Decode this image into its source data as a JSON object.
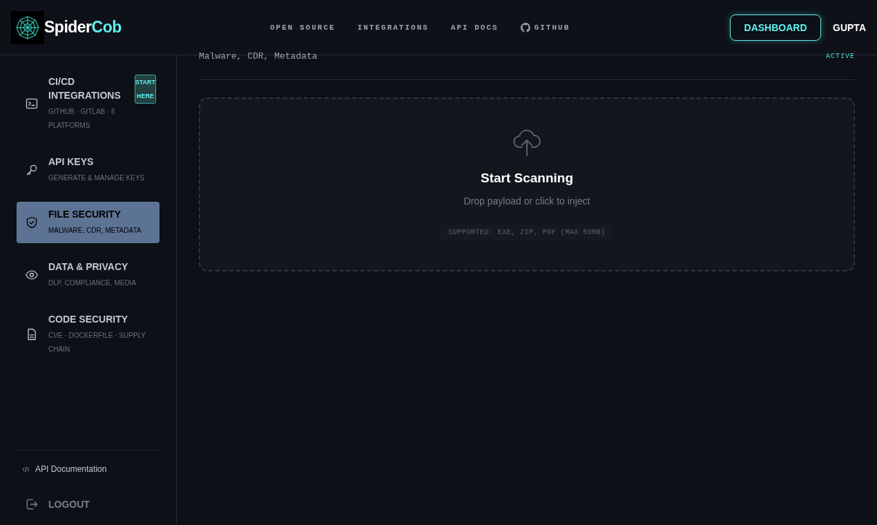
{
  "brand": {
    "name_first": "Spider",
    "name_second": "Cob"
  },
  "nav": [
    {
      "label": "OPEN SOURCE",
      "kind": "text"
    },
    {
      "label": "INTEGRATIONS",
      "kind": "text"
    },
    {
      "label": "API DOCS",
      "kind": "text"
    },
    {
      "label": "GITHUB",
      "kind": "github"
    }
  ],
  "dashboard_button": "DASHBOARD",
  "user": "GUPTA",
  "sidebar": {
    "items": [
      {
        "title": "CI/CD INTEGRATIONS",
        "subtitle": "GITHUB · GITLAB · 6 PLATFORMS",
        "kind": "terminal",
        "badge": "START HERE",
        "selected": false
      },
      {
        "title": "API KEYS",
        "subtitle": "GENERATE & MANAGE KEYS",
        "kind": "key",
        "selected": false
      },
      {
        "title": "FILE SECURITY",
        "subtitle": "MALWARE, CDR, METADATA",
        "kind": "shield",
        "selected": true
      },
      {
        "title": "DATA & PRIVACY",
        "subtitle": "DLP, COMPLIANCE, MEDIA",
        "kind": "eye",
        "selected": false
      },
      {
        "title": "CODE SECURITY",
        "subtitle": "CVE · DOCKERFILE · SUPPLY CHAIN",
        "kind": "file",
        "selected": false
      }
    ],
    "docs_link": "API Documentation",
    "logout": "LOGOUT"
  },
  "section": {
    "subtitle": "Malware, CDR, Metadata",
    "status": "ACTIVE"
  },
  "dropzone": {
    "title": "Start Scanning",
    "hint": "Drop payload or click to inject",
    "supported": "SUPPORTED: EXE, ZIP, PDF (MAX 50MB)"
  }
}
